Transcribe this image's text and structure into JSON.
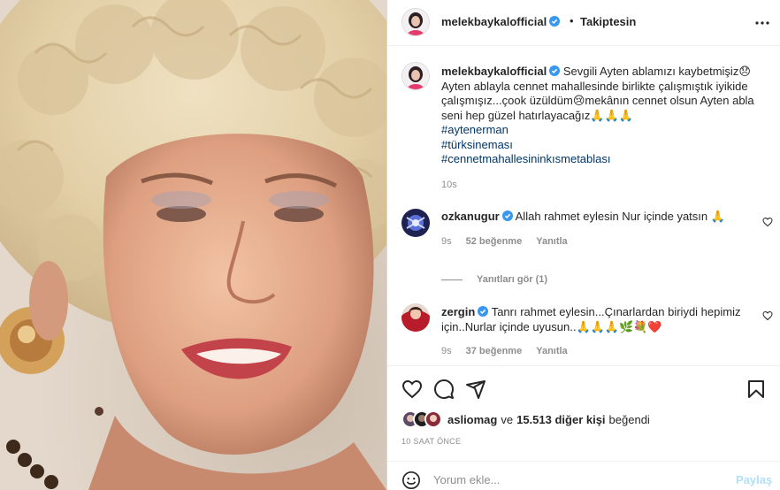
{
  "colors": {
    "text": "#262626",
    "secondary": "#8e8e8e",
    "link": "#00376b",
    "verified": "#3897f0",
    "post_button": "#b2dffc",
    "border": "#efefef"
  },
  "post": {
    "image_alt": "Photo of an older woman with curly blonde hair, smiling"
  },
  "header": {
    "username": "melekbaykalofficial",
    "dot": "•",
    "follow_status": "Takiptesin",
    "icons": [
      "verified-badge-icon",
      "more-options-icon"
    ]
  },
  "caption": {
    "username": "melekbaykalofficial",
    "text": "Sevgili Ayten ablamızı kaybetmişiz😞 Ayten ablayla cennet mahallesinde birlikte çalışmıştık iyikide çalışmışız...çook üzüldüm😢mekânın cennet olsun Ayten abla seni hep güzel hatırlayacağız🙏🙏🙏",
    "hashtags": [
      "#aytenerman",
      "#türksineması",
      "#cennetmahallesininkısmetablası"
    ],
    "time": "10s"
  },
  "comments": [
    {
      "username": "ozkanugur",
      "text": "Allah rahmet eylesin Nur içinde yatsın 🙏",
      "time": "9s",
      "likes": "52 beğenme",
      "reply": "Yanıtla"
    },
    {
      "username": "zergin",
      "text": "Tanrı rahmet eylesin...Çınarlardan biriydi hepimiz için..Nurlar içinde uyusun..🙏🙏🙏🌿💐❤️",
      "time": "9s",
      "likes": "37 beğenme",
      "reply": "Yanıtla"
    }
  ],
  "view_replies": "Yanıtları gör (1)",
  "actions": {
    "icons": [
      "heart-icon",
      "comment-icon",
      "share-icon",
      "bookmark-icon"
    ]
  },
  "likes": {
    "liker": "asliomag",
    "connector": "ve",
    "others": "15.513 diğer kişi",
    "verb": "beğendi"
  },
  "posted_ago": "10 SAAT ÖNCE",
  "add_comment": {
    "placeholder": "Yorum ekle...",
    "post_label": "Paylaş"
  }
}
